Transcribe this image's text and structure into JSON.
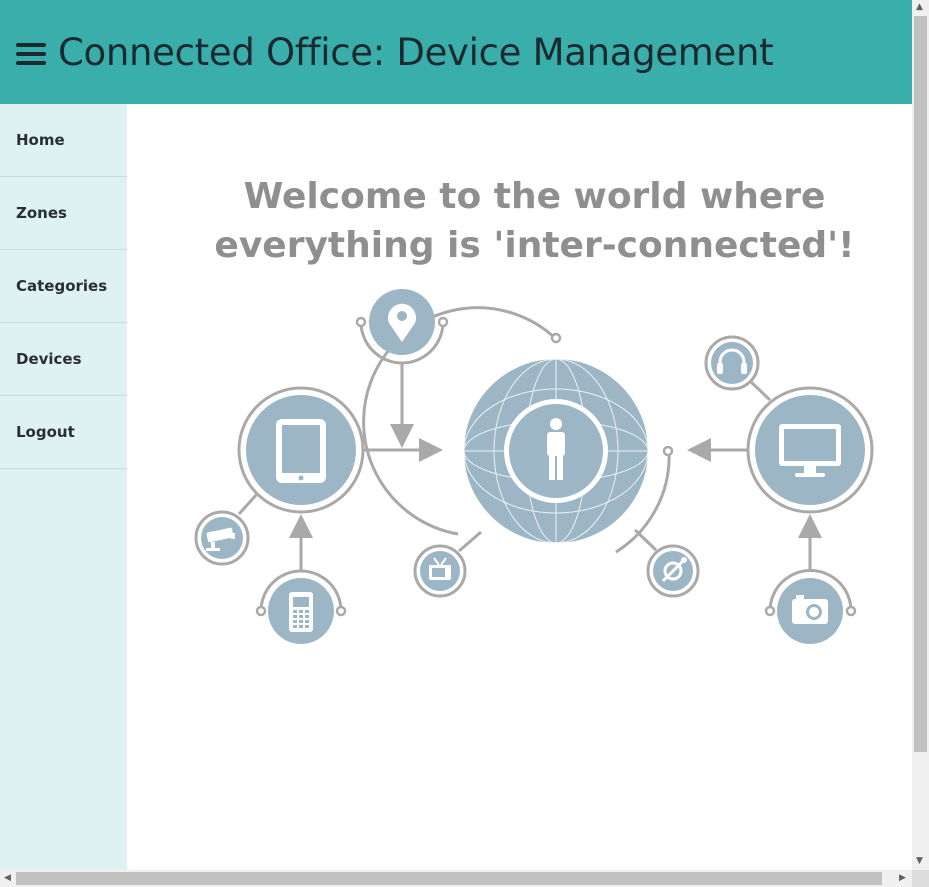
{
  "header": {
    "title": "Connected Office: Device Management",
    "menu_icon": "hamburger-menu-icon",
    "background": "#3aaeab"
  },
  "sidebar": {
    "background": "#dff2f2",
    "items": [
      {
        "label": "Home"
      },
      {
        "label": "Zones"
      },
      {
        "label": "Categories"
      },
      {
        "label": "Devices"
      },
      {
        "label": "Logout"
      }
    ]
  },
  "main": {
    "welcome_line1": "Welcome to the world where",
    "welcome_line2": "everything is 'inter-connected'!",
    "illustration": {
      "accent_color": "#9cb6c5",
      "line_color": "#a9a9a9",
      "icons": [
        "globe-icon",
        "person-icon",
        "tablet-icon",
        "location-pin-icon",
        "monitor-icon",
        "headphones-icon",
        "cctv-camera-icon",
        "mobile-phone-icon",
        "tv-icon",
        "satellite-icon",
        "camera-icon"
      ]
    }
  }
}
